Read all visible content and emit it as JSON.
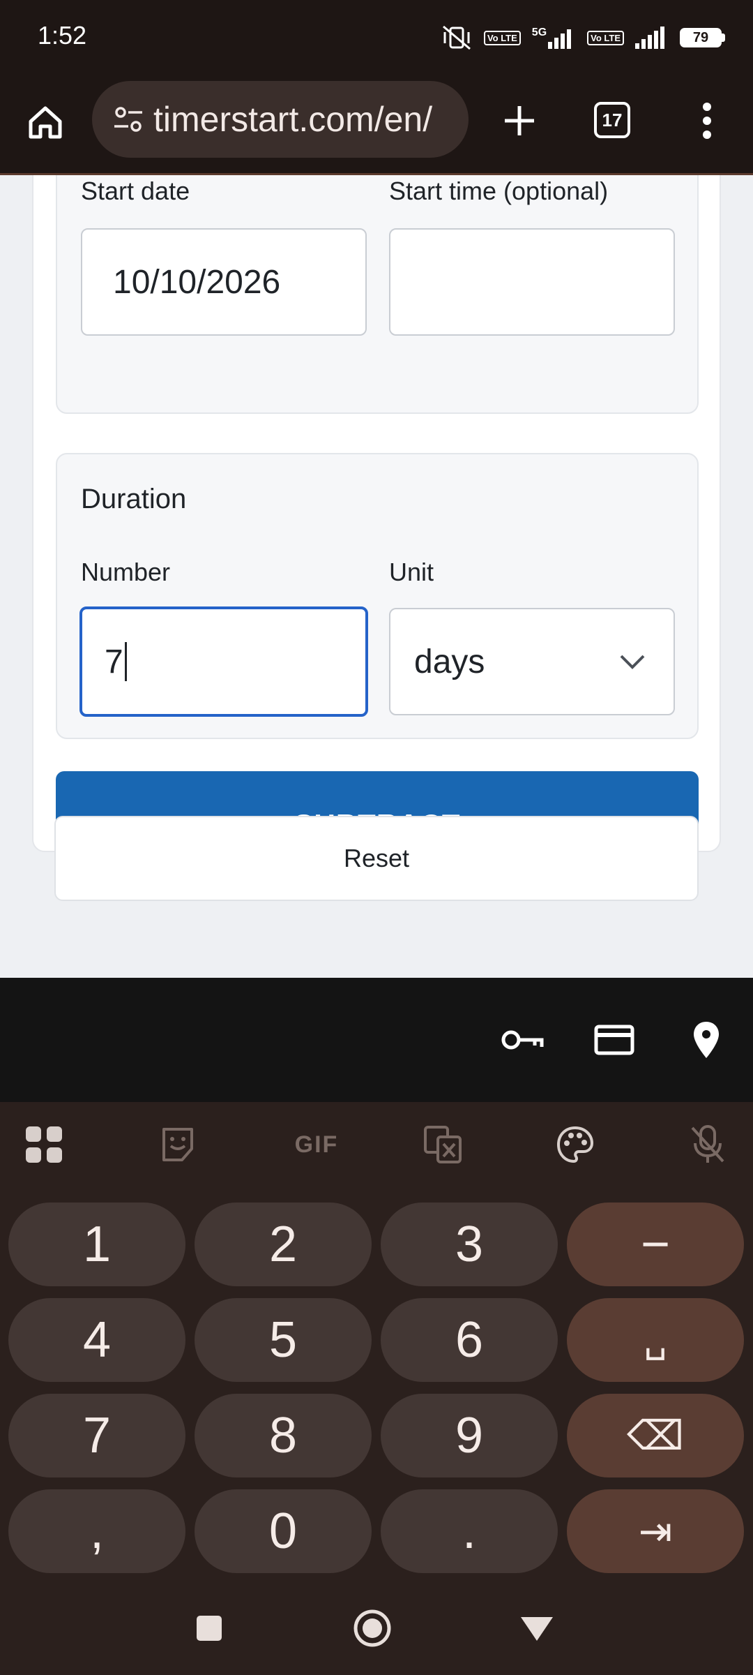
{
  "status_bar": {
    "time": "1:52",
    "network": "5G",
    "lte_badge_1": "Vo LTE",
    "lte_badge_2": "Vo LTE",
    "battery": "79"
  },
  "browser": {
    "url": "timerstart.com/en/",
    "tab_count": "17"
  },
  "form": {
    "start_date_label": "Start date",
    "start_time_label": "Start time (optional)",
    "start_date_value": "10/10/2026",
    "start_time_value": "",
    "duration_heading": "Duration",
    "number_label": "Number",
    "number_value": "7",
    "unit_label": "Unit",
    "unit_value": "days",
    "subtract_label": "SUBTRACT",
    "reset_label": "Reset"
  },
  "keyboard": {
    "toolbar_gif": "GIF",
    "keys": [
      [
        "1",
        "2",
        "3",
        "−"
      ],
      [
        "4",
        "5",
        "6",
        "␣"
      ],
      [
        "7",
        "8",
        "9",
        "⌫"
      ],
      [
        ",",
        "0",
        ".",
        "⇥"
      ]
    ]
  },
  "colors": {
    "accent": "#1967b2",
    "focus_border": "#2563c9",
    "keyboard_bg": "#2b201d",
    "key_bg": "#433734",
    "key_fn_bg": "#5a3d33"
  }
}
